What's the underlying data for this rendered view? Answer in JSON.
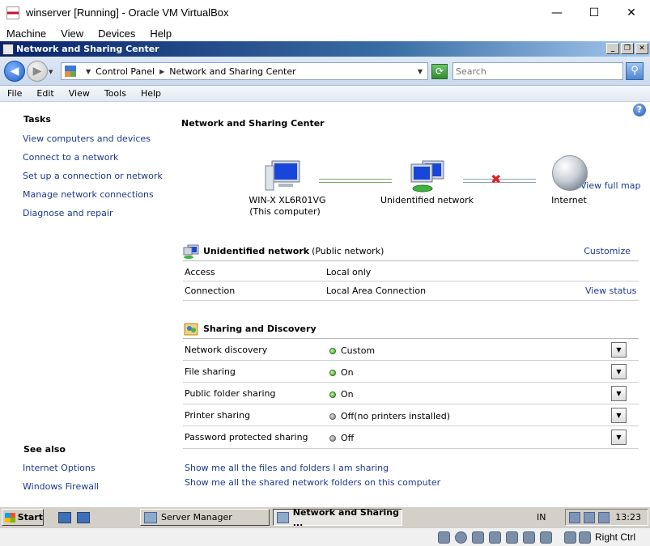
{
  "vbox": {
    "title": "winserver [Running] - Oracle VM VirtualBox",
    "menu": [
      "Machine",
      "View",
      "Devices",
      "Help"
    ],
    "host_key": "Right Ctrl"
  },
  "guest_window": {
    "title": "Network and Sharing Center"
  },
  "address_bar": {
    "crumbs": [
      "Control Panel",
      "Network and Sharing Center"
    ],
    "search_placeholder": "Search"
  },
  "menu": [
    "File",
    "Edit",
    "View",
    "Tools",
    "Help"
  ],
  "sidebar": {
    "tasks_heading": "Tasks",
    "tasks": [
      "View computers and devices",
      "Connect to a network",
      "Set up a connection or network",
      "Manage network connections",
      "Diagnose and repair"
    ],
    "see_also_heading": "See also",
    "see_also": [
      "Internet Options",
      "Windows Firewall"
    ]
  },
  "main": {
    "title": "Network and Sharing Center",
    "view_full_map": "View full map",
    "map": {
      "computer": "WIN-X  XL6R01VG",
      "computer_sub": "(This computer)",
      "network": "Unidentified network",
      "internet": "Internet"
    },
    "network_section": {
      "title": "Unidentified network",
      "subtitle": "(Public network)",
      "customize": "Customize",
      "rows": [
        {
          "label": "Access",
          "value": "Local only",
          "action": ""
        },
        {
          "label": "Connection",
          "value": "Local Area Connection",
          "action": "View status"
        }
      ]
    },
    "sharing_section": {
      "title": "Sharing and Discovery",
      "rows": [
        {
          "label": "Network discovery",
          "value": "Custom",
          "status": "green"
        },
        {
          "label": "File sharing",
          "value": "On",
          "status": "green"
        },
        {
          "label": "Public folder sharing",
          "value": "On",
          "status": "green"
        },
        {
          "label": "Printer sharing",
          "value": "Off(no printers installed)",
          "status": "gray"
        },
        {
          "label": "Password protected sharing",
          "value": "Off",
          "status": "gray"
        }
      ]
    },
    "bottom_links": [
      "Show me all the files and folders I am sharing",
      "Show me all the shared network folders on this computer"
    ]
  },
  "taskbar": {
    "start": "Start",
    "tasks": [
      "Server Manager",
      "Network and Sharing ..."
    ],
    "lang": "IN",
    "clock": "13:23"
  },
  "colors": {
    "link": "#1c3a8c",
    "title_bar": "#0a246a",
    "status_on": "#2e9c1f"
  }
}
